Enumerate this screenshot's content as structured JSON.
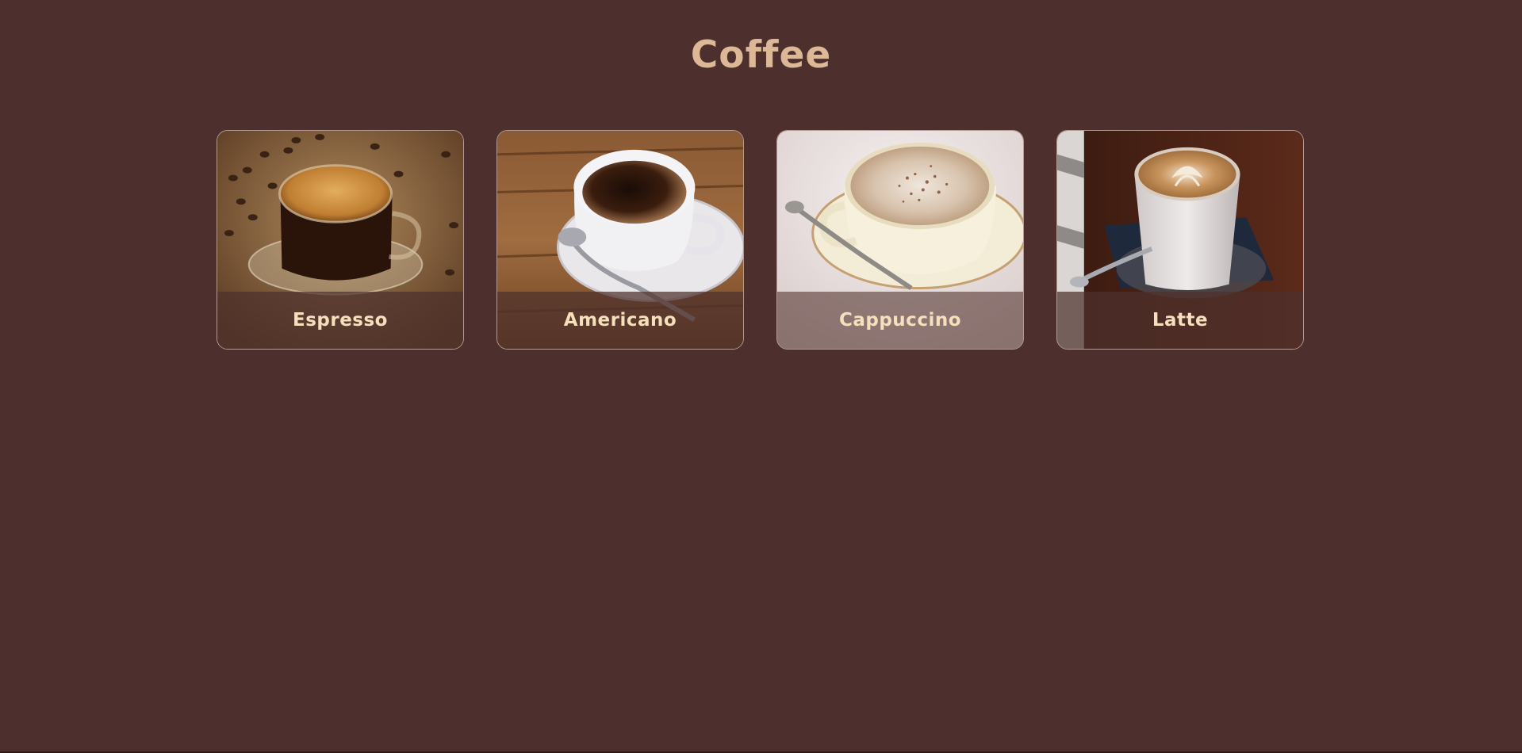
{
  "page": {
    "title": "Coffee",
    "background_color": "#4d302d",
    "accent_color": "#dcb896"
  },
  "cards": [
    {
      "label": "Espresso",
      "icon": "espresso-cup-image"
    },
    {
      "label": "Americano",
      "icon": "americano-cup-image"
    },
    {
      "label": "Cappuccino",
      "icon": "cappuccino-cup-image"
    },
    {
      "label": "Latte",
      "icon": "latte-glass-image"
    }
  ]
}
